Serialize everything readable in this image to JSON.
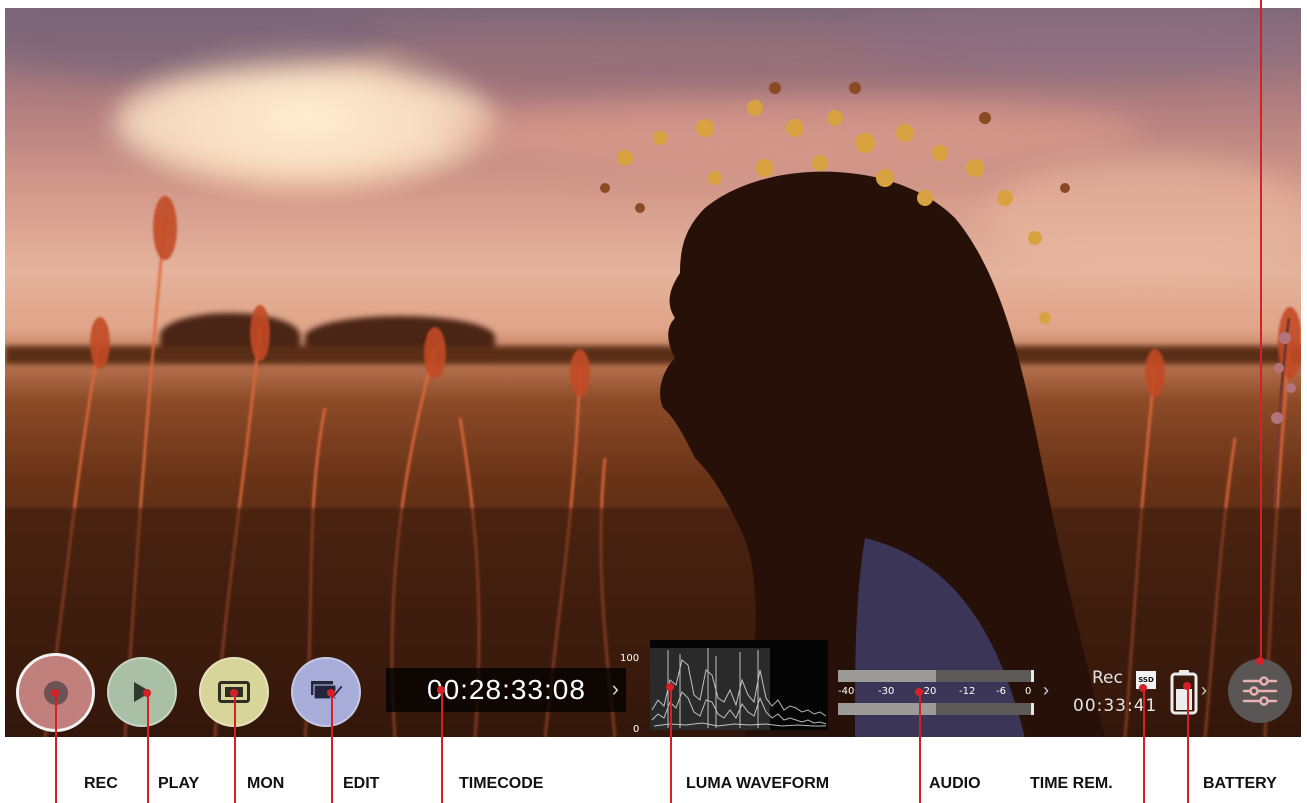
{
  "status_bar": {
    "timecode": "00:28:33:08",
    "waveform_scale_top": "100",
    "waveform_scale_bottom": "0",
    "audio_scale": [
      "-40",
      "-30",
      "-20",
      "-12",
      "-6",
      "0"
    ],
    "audio_levels": {
      "channel_1": 0.5,
      "channel_2": 0.5
    },
    "rec_label": "Rec",
    "media_badge": "SSD",
    "time_remaining": "00:33:41",
    "battery_level": 0.6
  },
  "buttons": {
    "rec": "record-icon",
    "play": "play-icon",
    "mon": "monitor-icon",
    "edit": "edit-icon",
    "settings": "sliders-icon"
  },
  "callouts": {
    "rec": "REC",
    "play": "PLAY",
    "mon": "MON",
    "edit": "EDIT",
    "timecode": "TIMECODE",
    "luma_waveform": "LUMA WAVEFORM",
    "audio": "AUDIO",
    "time_rem": "TIME REM.",
    "battery": "BATTERY"
  },
  "colors": {
    "leader": "#d62027",
    "rec_button": "#c2807c",
    "play_button": "#a9bfa6",
    "mon_button": "#d7d59a",
    "edit_button": "#a7acd9",
    "settings_button": "#5a5656"
  }
}
